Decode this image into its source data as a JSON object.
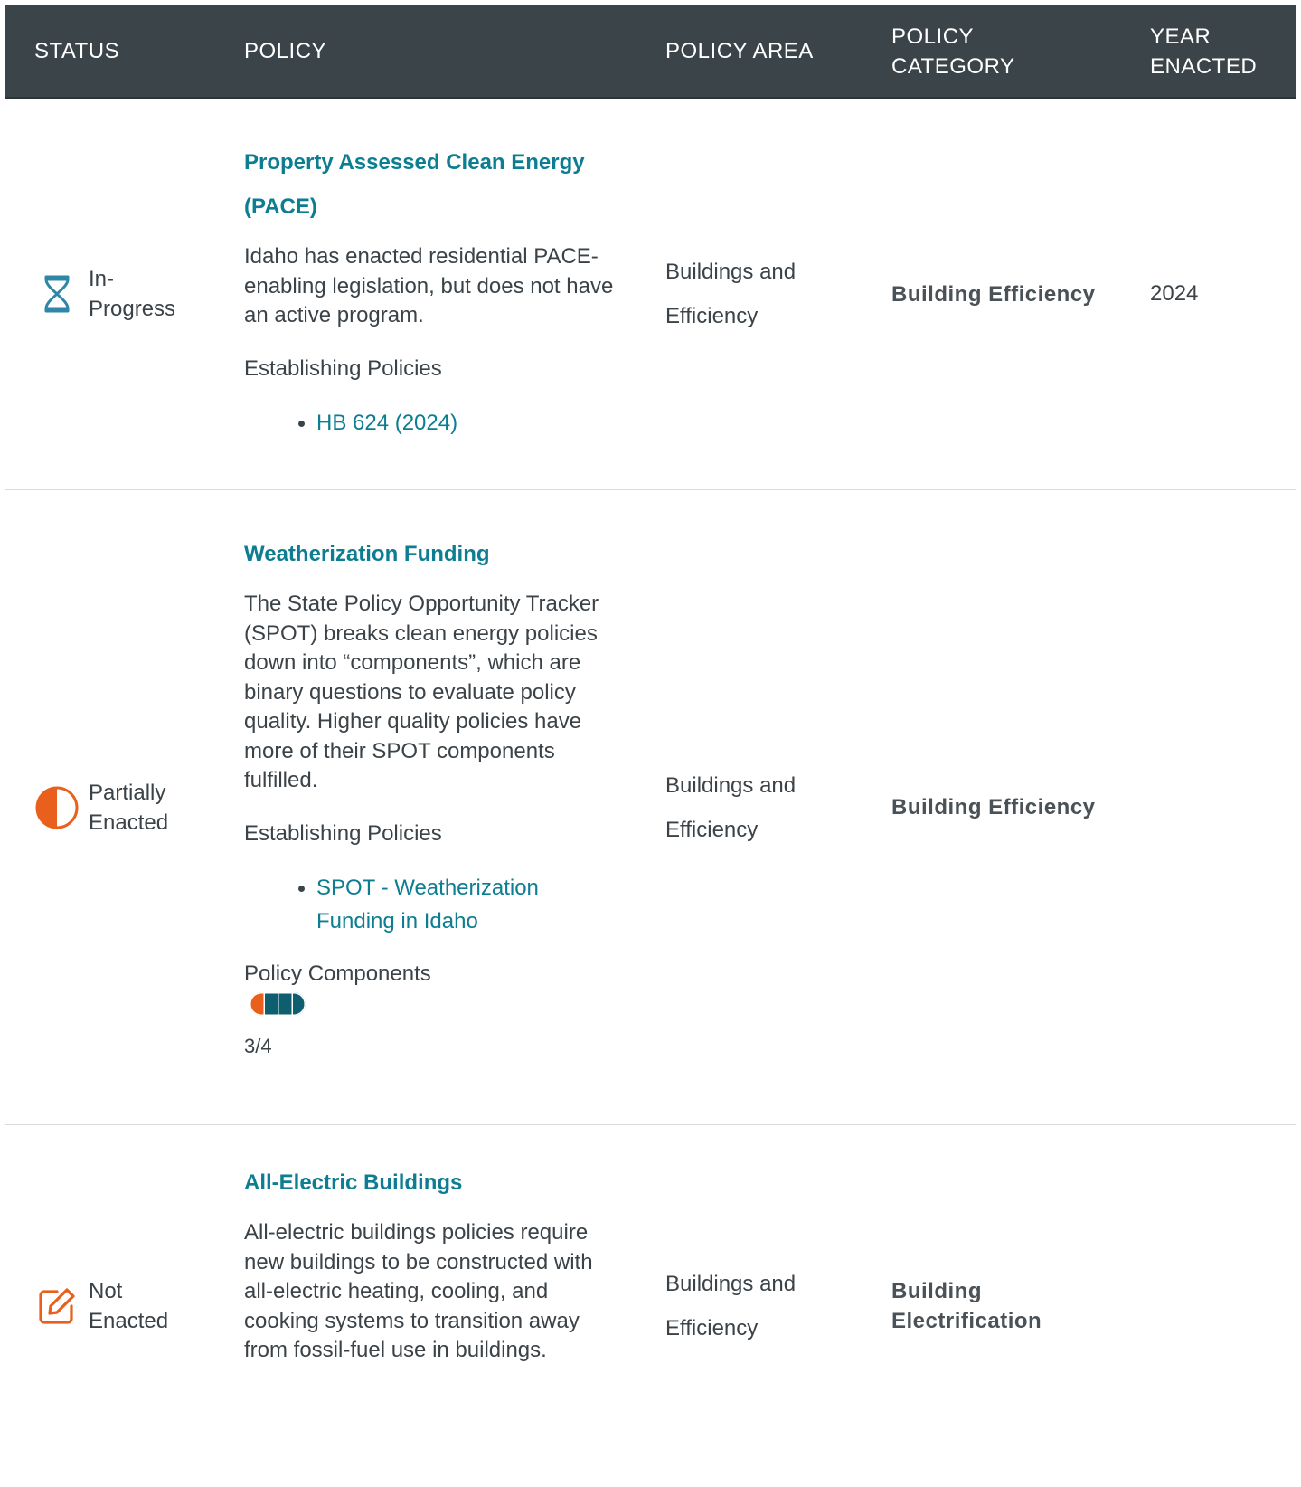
{
  "header": {
    "status": "STATUS",
    "policy": "POLICY",
    "policy_area": "POLICY AREA",
    "policy_category": "POLICY\nCATEGORY",
    "year_enacted": "YEAR\nENACTED"
  },
  "rows": [
    {
      "status": "In-\nProgress",
      "status_icon": "hourglass-icon",
      "title": "Property Assessed Clean Energy (PACE)",
      "description": "Idaho has enacted residential PACE-enabling legislation, but does not have an active program.",
      "establishing_label": "Establishing Policies",
      "links": [
        "HB 624 (2024)"
      ],
      "policy_area": "Buildings and Efficiency",
      "policy_category": "Building Efficiency",
      "year": "2024"
    },
    {
      "status": "Partially\nEnacted",
      "status_icon": "half-circle-icon",
      "title": "Weatherization Funding",
      "description": "The State Policy Opportunity Tracker (SPOT) breaks clean energy policies down into “components”, which are binary questions to evaluate policy quality. Higher quality policies have more of their SPOT components fulfilled.",
      "establishing_label": "Establishing Policies",
      "links": [
        "SPOT - Weatherization Funding in Idaho"
      ],
      "components_label": "Policy Components",
      "components_fulfilled": 3,
      "components_total": 4,
      "components_text": "3/4",
      "policy_area": "Buildings and Efficiency",
      "policy_category": "Building Efficiency",
      "year": ""
    },
    {
      "status": "Not\nEnacted",
      "status_icon": "edit-icon",
      "title": "All-Electric Buildings",
      "description": "All-electric buildings policies require new buildings to be constructed with all-electric heating, cooling, and cooking systems to transition away from fossil-fuel use in buildings.",
      "policy_area": "Buildings and Efficiency",
      "policy_category": "Building Electrification",
      "year": ""
    }
  ],
  "colors": {
    "header_bg": "#3b4549",
    "link": "#0d7d91",
    "orange": "#e8601c",
    "teal": "#0d5e6e",
    "icon_blue": "#2f86a6"
  }
}
